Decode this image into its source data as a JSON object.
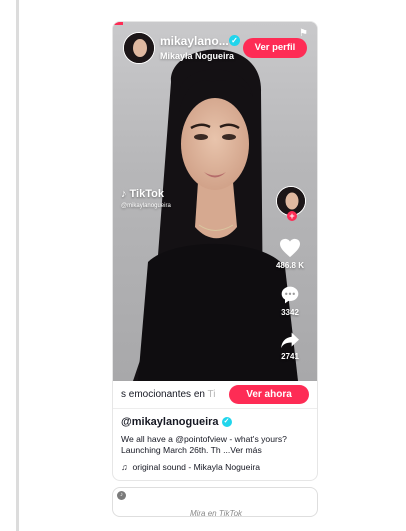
{
  "creator": {
    "username_short": "mikaylano...",
    "full_name": "Mikayla Nogueira",
    "view_profile_label": "Ver perfil"
  },
  "watermark": {
    "logo_text": "TikTok",
    "handle": "@mikaylanogueira"
  },
  "actions": {
    "likes": "486.8 K",
    "comments": "3342",
    "shares": "2741"
  },
  "cta": {
    "text_main": "s emocionantes en ",
    "text_faded": "Ti",
    "button_label": "Ver ahora"
  },
  "caption": {
    "username": "@mikaylanogueira",
    "text": "We all have a @pointofview - what's yours? Launching March 26th. Th ...Ver más",
    "sound": "original sound - Mikayla Nogueira"
  },
  "footer": {
    "label": "Mira en TikTok"
  },
  "colors": {
    "accent": "#fe2c55",
    "verified": "#20d5ec"
  }
}
